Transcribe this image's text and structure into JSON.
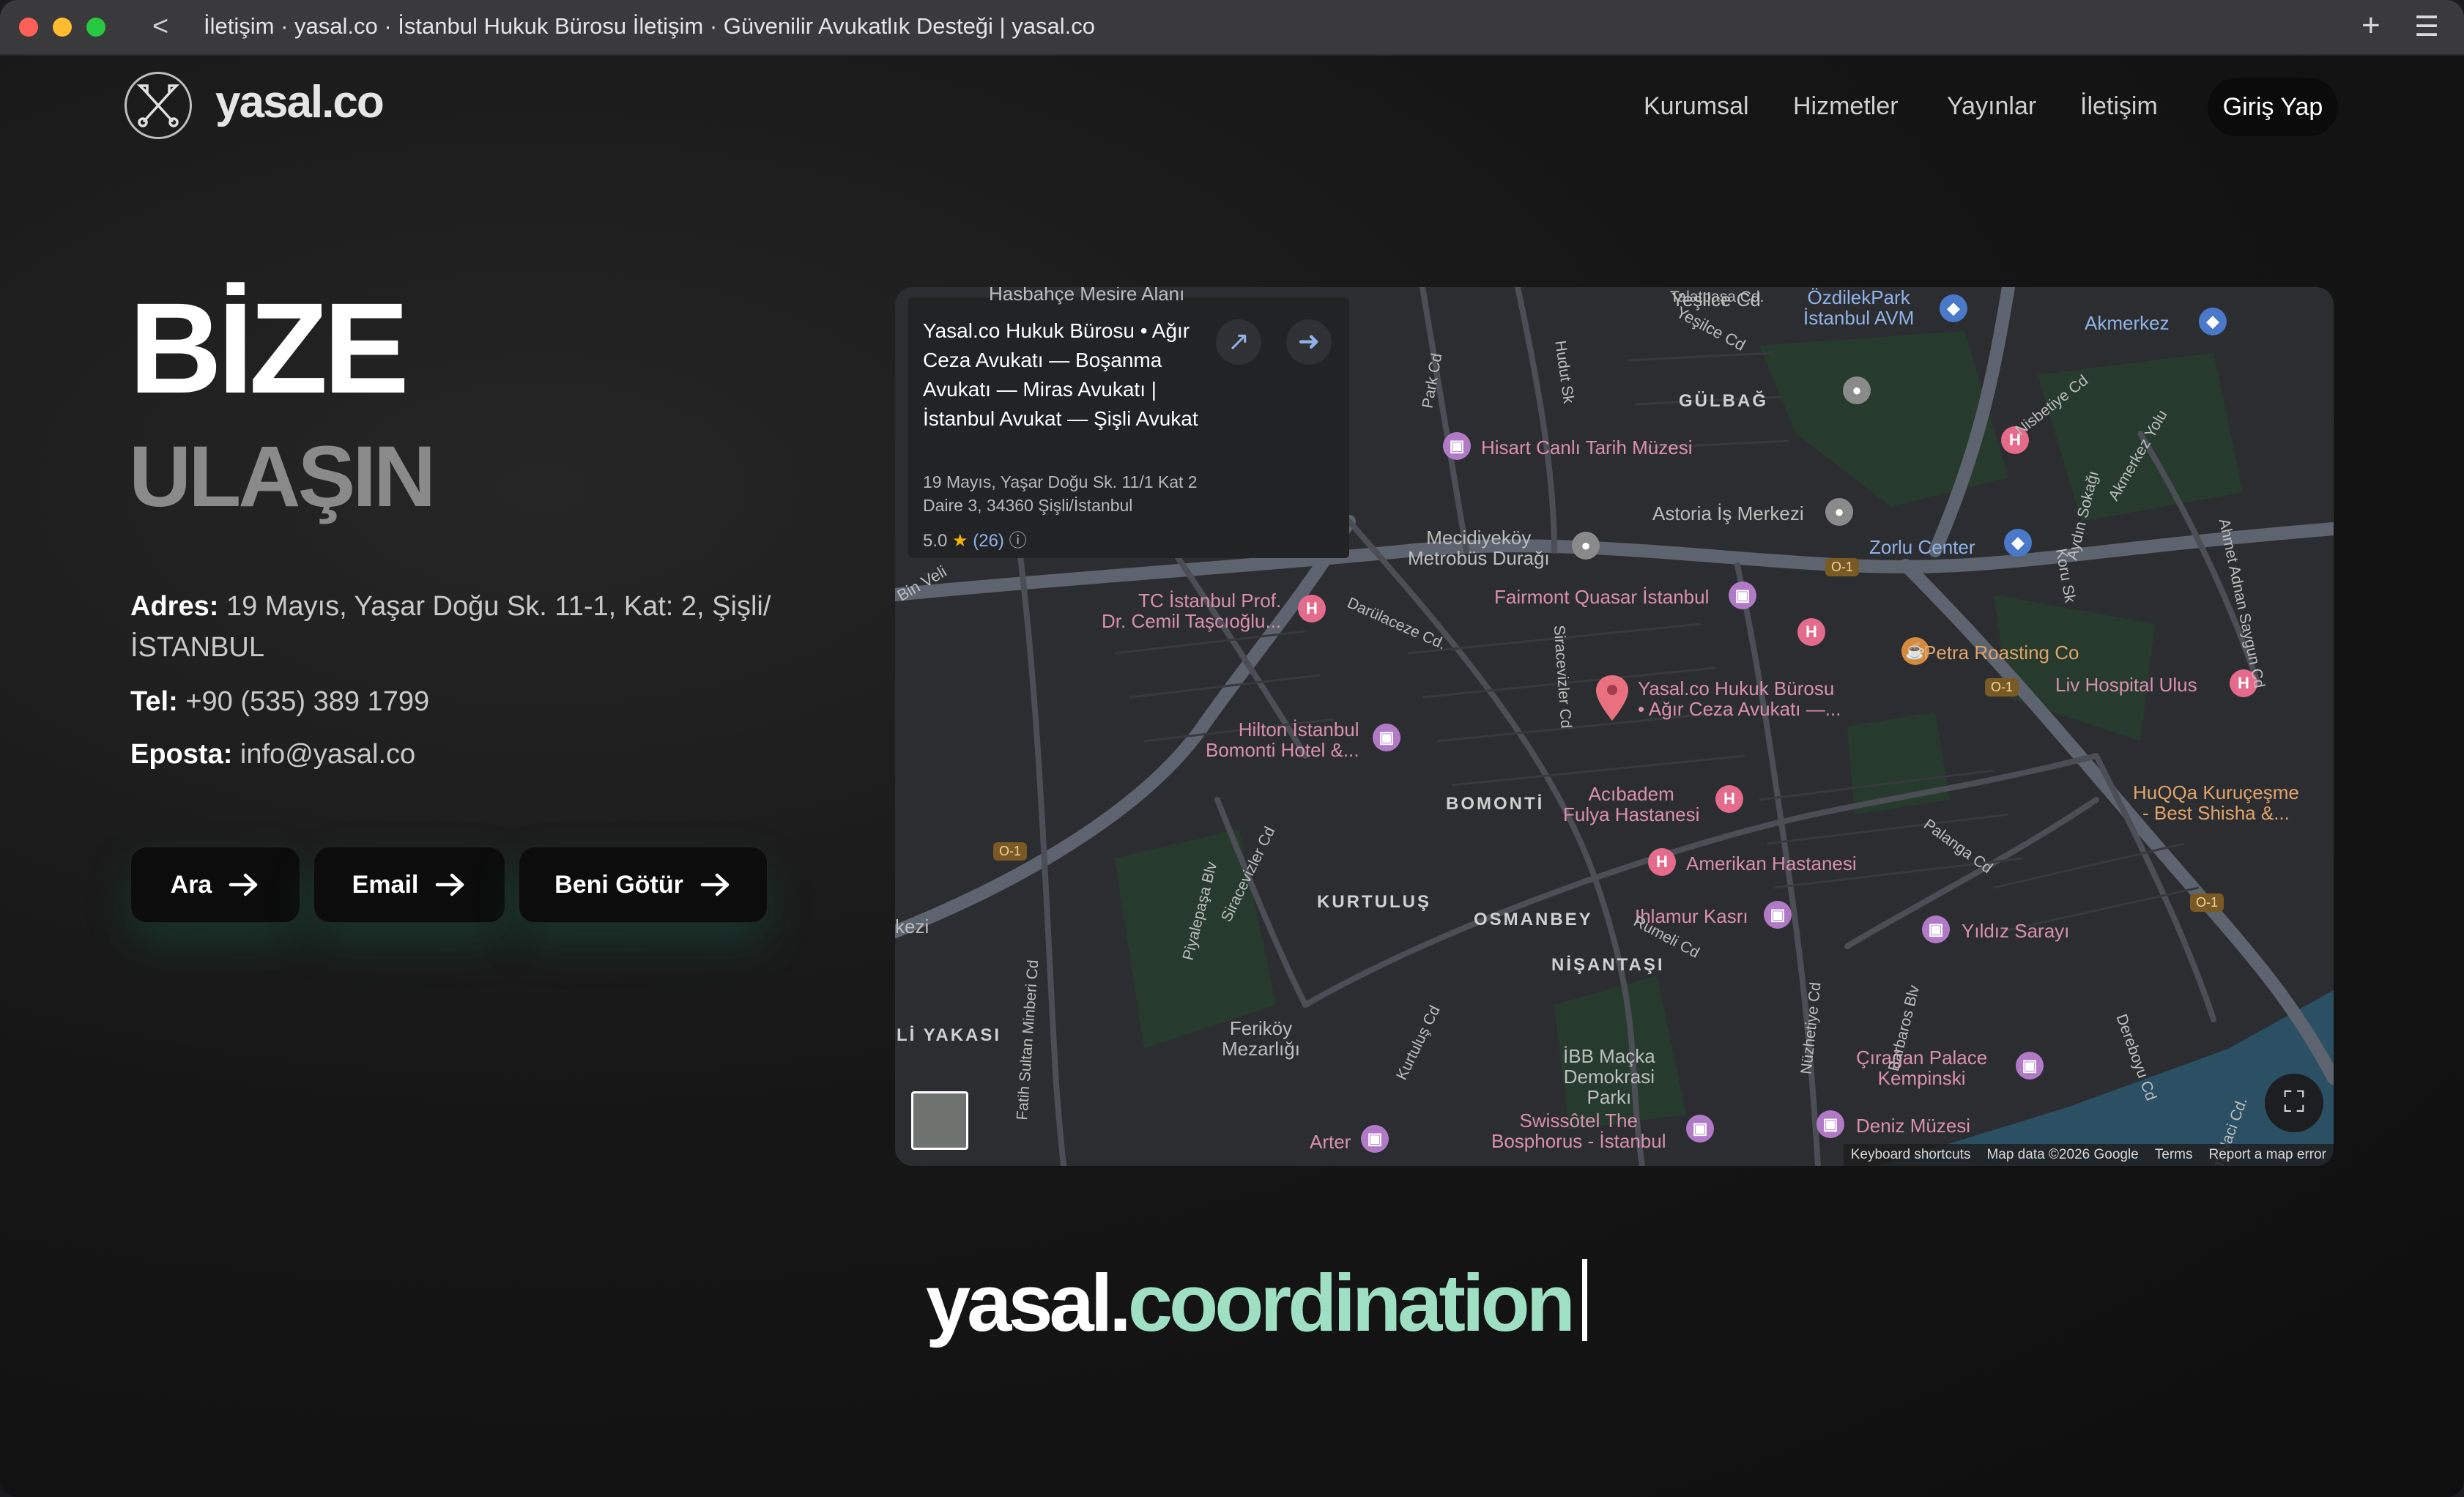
{
  "browser": {
    "title": "İletişim · yasal.co · İstanbul Hukuk Bürosu İletişim · Güvenilir Avukatlık Desteği | yasal.co",
    "back_glyph": "<",
    "new_tab_glyph": "+",
    "menu_glyph": "☰",
    "traffic_colors": [
      "#fe5f57",
      "#febc2e",
      "#28c840"
    ]
  },
  "header": {
    "logo_text": "yasal.co",
    "logo_icon": "crossed-tools-icon",
    "nav": [
      "Kurumsal",
      "Hizmetler",
      "Yayınlar",
      "İletişim"
    ],
    "login_label": "Giriş Yap"
  },
  "hero": {
    "line1": "BİZE",
    "line2": "ULAŞIN"
  },
  "contact": {
    "address_label": "Adres:",
    "address_value": "19 Mayıs, Yaşar Doğu Sk. 11-1, Kat: 2, Şişli/ İSTANBUL",
    "phone_label": "Tel:",
    "phone_value": "+90 (535) 389 1799",
    "email_label": "Eposta:",
    "email_value": "info@yasal.co"
  },
  "actions": [
    {
      "label": "Ara",
      "icon": "arrow-right-icon"
    },
    {
      "label": "Email",
      "icon": "arrow-right-icon"
    },
    {
      "label": "Beni Götür",
      "icon": "arrow-right-icon"
    }
  ],
  "map": {
    "card": {
      "title": "Yasal.co Hukuk Bürosu • Ağır Ceza Avukatı — Boşanma Avukatı — Miras Avukatı | İstanbul Avukat — Şişli Avukat",
      "address": "19 Mayıs, Yaşar Doğu Sk. 11/1 Kat 2 Daire 3, 34360 Şişli/İstanbul",
      "rating": "5.0",
      "star": "★",
      "reviews": "(26)",
      "info_glyph": "ⓘ"
    },
    "footer": [
      "Keyboard shortcuts",
      "Map data ©2026 Google",
      "Terms",
      "Report a map error"
    ],
    "pin_label": "Yasal.co Hukuk Bürosu\n• Ağır Ceza Avukatı —...",
    "labels": {
      "hasbahce": "Hasbahçe Mesire Alanı",
      "talatpasa": "Talatpaşa Cd.",
      "yesilce": "Yeşilce Cd",
      "ozdilek": "ÖzdilekPark\nİstanbul AVM",
      "akmerkez": "Akmerkez",
      "gulbag": "GÜLBAĞ",
      "hisart": "Hisart Canlı Tarih Müzesi",
      "astoria": "Astoria İş Merkezi",
      "mecidiyekoy": "Mecidiyeköy\nMetrobüs Durağı",
      "zorlu": "Zorlu Center",
      "fairmont": "Fairmont Quasar İstanbul",
      "tc_istanbul": "TC İstanbul Prof.\nDr. Cemil Taşcıoğlu...",
      "darulaceze": "Darülaceze Cd.",
      "petra": "Petra Roasting Co",
      "liv": "Liv Hospital Ulus",
      "hilton": "Hilton İstanbul\nBomonti Hotel &...",
      "bomonti": "BOMONTİ",
      "acibadem": "Acıbadem\nFulya Hastanesi",
      "huqqa": "HuQQa Kuruçeşme\n- Best Shisha &...",
      "amerikan": "Amerikan Hastanesi",
      "kurtulus": "KURTULUŞ",
      "osmanbey": "OSMANBEY",
      "ihlamur": "Ihlamur Kasrı",
      "yildiz": "Yıldız Sarayı",
      "nisantasi": "NİŞANTAŞI",
      "ferikoy": "Feriköy\nMezarlığı",
      "ibb": "İBB Maçka\nDemokrasi\nParkı",
      "ciragan": "Çırağan Palace\nKempinski",
      "swissotel": "Swissôtel The\nBosphorus - İstanbul",
      "deniz": "Deniz Müzesi",
      "arter": "Arter",
      "kezi": "kezi",
      "li_yakasi": "Lİ YAKASI",
      "bin_veli": "Bin Veli",
      "siracevizler": "Siracevizler Cd",
      "rumeli": "Rumeli Cd",
      "palanga": "Palanga Cd",
      "hudut": "Hudut Sk",
      "park_cd": "Park Cd",
      "nisbetiye": "Nisbetiye Cd",
      "akmerkez_yolu": "Akmerkez Yolu",
      "aydin": "Aydın Sokağı",
      "koru": "Koru Sk",
      "ahmet_adnan": "Ahmet Adnan Saygun Cd",
      "dereboyu": "Dereboyu Cd",
      "muallim": "Muallim Naci Cd.",
      "barbaros": "Barbaros Blv",
      "nuzhetiye": "Nüzhetiye Cd",
      "kurtulus_cd": "Kurtuluş Cd",
      "piyalepasa": "Piyalepaşa Blv",
      "fatih_sultan": "Fatih Sultan Minberi Cd",
      "shield_o1": "O-1"
    },
    "colors": {
      "land": "#2c2d30",
      "road": "#4b4e55",
      "highway": "#5d6470",
      "park": "#263b2d",
      "water": "#2b4f63"
    }
  },
  "slogan": {
    "part1": "yasal.",
    "part2": "coordination"
  }
}
